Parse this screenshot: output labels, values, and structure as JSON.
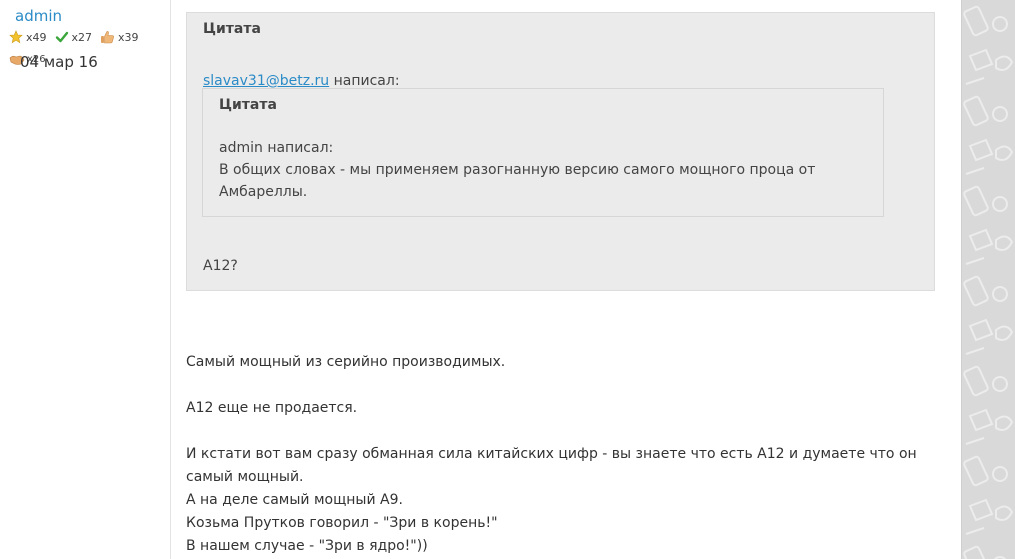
{
  "user": {
    "name": "admin",
    "reputation": [
      {
        "icon": "star-icon",
        "count": "x49"
      },
      {
        "icon": "checkmark-icon",
        "count": "x27"
      },
      {
        "icon": "thumbs-up-icon",
        "count": "x39"
      }
    ],
    "extra_reputation": {
      "icon": "handshake-icon",
      "count": "x26"
    },
    "join_date": "04 мар 16"
  },
  "post": {
    "quote_label": "Цитата",
    "outer_quote": {
      "author_email": "slavav31@betz.ru",
      "wrote": "написал:",
      "reply": "А12?"
    },
    "inner_quote": {
      "label": "Цитата",
      "author_line": "admin написал:",
      "text_line_1": "В общих словах - мы применяем разогнанную версию самого мощного проца от",
      "text_line_2": "Амбареллы."
    },
    "body": {
      "p1": "Самый мощный из серийно производимых.",
      "p2": "А12 еще не продается.",
      "p3_line_1": "И кстати вот вам сразу обманная сила китайских цифр - вы знаете что есть А12 и думаете что он",
      "p3_line_2": "самый мощный.",
      "p3_line_3": "А на деле самый мощный А9.",
      "p3_line_4": "Козьма Прутков говорил - \"Зри в корень!\"",
      "p3_line_5": "В нашем случае - \"Зри в ядро!\"))"
    }
  },
  "colors": {
    "link": "#2b8bc7",
    "quote_bg": "#ebebeb",
    "strip_bg": "#d9d9d9"
  }
}
